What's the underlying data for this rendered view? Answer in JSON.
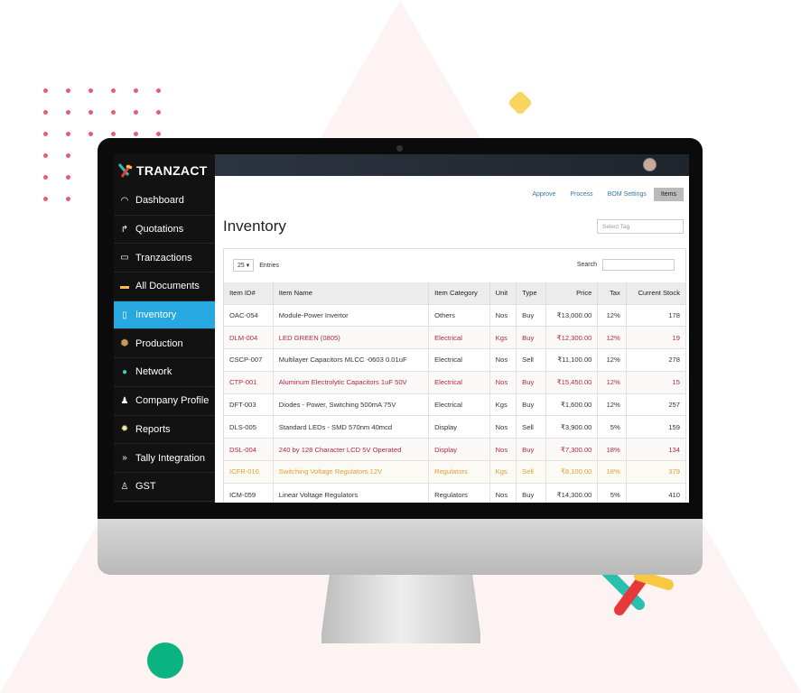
{
  "brand": {
    "name": "TRANZACT",
    "accent": "#27a8e0"
  },
  "sidebar": {
    "items": [
      {
        "label": "Dashboard",
        "icon": "gauge-icon"
      },
      {
        "label": "Quotations",
        "icon": "arrow-turn-icon"
      },
      {
        "label": "Tranzactions",
        "icon": "book-icon"
      },
      {
        "label": "All Documents",
        "icon": "folder-icon"
      },
      {
        "label": "Inventory",
        "icon": "document-icon",
        "active": true
      },
      {
        "label": "Production",
        "icon": "box-icon"
      },
      {
        "label": "Network",
        "icon": "globe-icon"
      },
      {
        "label": "Company Profile",
        "icon": "user-icon"
      },
      {
        "label": "Reports",
        "icon": "bulb-icon"
      },
      {
        "label": "Tally Integration",
        "icon": "double-chevron-icon"
      },
      {
        "label": "GST",
        "icon": "money-bag-icon"
      }
    ]
  },
  "tabs": [
    "Approve",
    "Process",
    "BOM Settings",
    "Items"
  ],
  "active_tab": "Items",
  "page_title": "Inventory",
  "select_tag_placeholder": "Select Tag",
  "entries": {
    "value": "25",
    "label": "Entries"
  },
  "search_label": "Search",
  "table": {
    "columns": [
      "Item ID#",
      "Item Name",
      "Item Category",
      "Unit",
      "Type",
      "Price",
      "Tax",
      "Current Stock"
    ],
    "rows": [
      {
        "style": "normal",
        "cells": [
          "OAC-054",
          "Module-Power Invertor",
          "Others",
          "Nos",
          "Buy",
          "₹13,000.00",
          "12%",
          "178"
        ]
      },
      {
        "style": "red",
        "cells": [
          "DLM-004",
          "LED GREEN (0805)",
          "Electrical",
          "Kgs",
          "Buy",
          "₹12,300.00",
          "12%",
          "19"
        ]
      },
      {
        "style": "normal",
        "cells": [
          "CSCP-007",
          "Multilayer Capacitors MLCC -0603 0.01uF",
          "Electrical",
          "Nos",
          "Sell",
          "₹11,100.00",
          "12%",
          "278"
        ]
      },
      {
        "style": "red",
        "cells": [
          "CTP-001",
          "Aluminum Electrolytic Capacitors 1uF 50V",
          "Electrical",
          "Nos",
          "Buy",
          "₹15,450.00",
          "12%",
          "15"
        ]
      },
      {
        "style": "normal",
        "cells": [
          "DFT-003",
          "Diodes - Power, Switching 500mA 75V",
          "Electrical",
          "Kgs",
          "Buy",
          "₹1,600.00",
          "12%",
          "257"
        ]
      },
      {
        "style": "normal",
        "cells": [
          "DLS-005",
          "Standard LEDs - SMD 570nm 40mcd",
          "Display",
          "Nos",
          "Sell",
          "₹3,900.00",
          "5%",
          "159"
        ]
      },
      {
        "style": "red",
        "cells": [
          "DSL-004",
          "240 by 128 Character LCD 5V Operated",
          "Display",
          "Nos",
          "Buy",
          "₹7,300.00",
          "18%",
          "134"
        ]
      },
      {
        "style": "amber",
        "cells": [
          "ICFR-016",
          "Switching Voltage Regulators 12V",
          "Regulators",
          "Kgs",
          "Sell",
          "₹8,100.00",
          "18%",
          "379"
        ]
      },
      {
        "style": "normal",
        "cells": [
          "ICM-059",
          "Linear Voltage Regulators",
          "Regulators",
          "Nos",
          "Buy",
          "₹14,300.00",
          "5%",
          "410"
        ]
      }
    ]
  }
}
